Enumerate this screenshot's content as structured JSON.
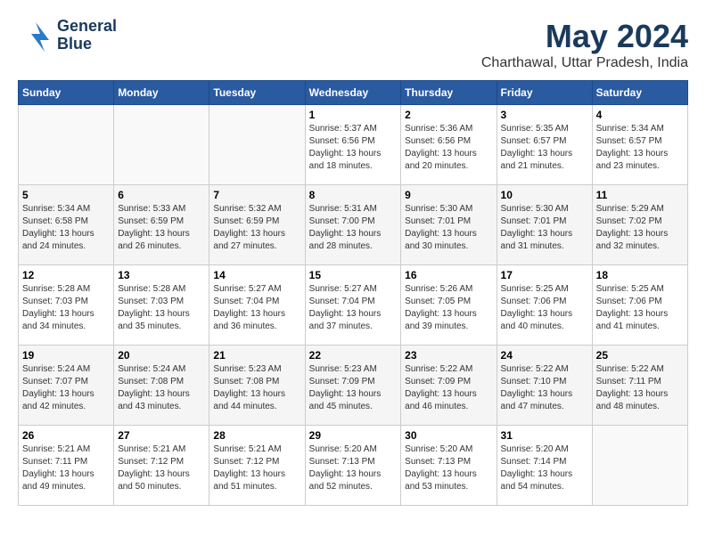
{
  "header": {
    "logo_line1": "General",
    "logo_line2": "Blue",
    "main_title": "May 2024",
    "subtitle": "Charthawal, Uttar Pradesh, India"
  },
  "calendar": {
    "weekdays": [
      "Sunday",
      "Monday",
      "Tuesday",
      "Wednesday",
      "Thursday",
      "Friday",
      "Saturday"
    ],
    "weeks": [
      [
        {
          "day": "",
          "info": ""
        },
        {
          "day": "",
          "info": ""
        },
        {
          "day": "",
          "info": ""
        },
        {
          "day": "1",
          "info": "Sunrise: 5:37 AM\nSunset: 6:56 PM\nDaylight: 13 hours\nand 18 minutes."
        },
        {
          "day": "2",
          "info": "Sunrise: 5:36 AM\nSunset: 6:56 PM\nDaylight: 13 hours\nand 20 minutes."
        },
        {
          "day": "3",
          "info": "Sunrise: 5:35 AM\nSunset: 6:57 PM\nDaylight: 13 hours\nand 21 minutes."
        },
        {
          "day": "4",
          "info": "Sunrise: 5:34 AM\nSunset: 6:57 PM\nDaylight: 13 hours\nand 23 minutes."
        }
      ],
      [
        {
          "day": "5",
          "info": "Sunrise: 5:34 AM\nSunset: 6:58 PM\nDaylight: 13 hours\nand 24 minutes."
        },
        {
          "day": "6",
          "info": "Sunrise: 5:33 AM\nSunset: 6:59 PM\nDaylight: 13 hours\nand 26 minutes."
        },
        {
          "day": "7",
          "info": "Sunrise: 5:32 AM\nSunset: 6:59 PM\nDaylight: 13 hours\nand 27 minutes."
        },
        {
          "day": "8",
          "info": "Sunrise: 5:31 AM\nSunset: 7:00 PM\nDaylight: 13 hours\nand 28 minutes."
        },
        {
          "day": "9",
          "info": "Sunrise: 5:30 AM\nSunset: 7:01 PM\nDaylight: 13 hours\nand 30 minutes."
        },
        {
          "day": "10",
          "info": "Sunrise: 5:30 AM\nSunset: 7:01 PM\nDaylight: 13 hours\nand 31 minutes."
        },
        {
          "day": "11",
          "info": "Sunrise: 5:29 AM\nSunset: 7:02 PM\nDaylight: 13 hours\nand 32 minutes."
        }
      ],
      [
        {
          "day": "12",
          "info": "Sunrise: 5:28 AM\nSunset: 7:03 PM\nDaylight: 13 hours\nand 34 minutes."
        },
        {
          "day": "13",
          "info": "Sunrise: 5:28 AM\nSunset: 7:03 PM\nDaylight: 13 hours\nand 35 minutes."
        },
        {
          "day": "14",
          "info": "Sunrise: 5:27 AM\nSunset: 7:04 PM\nDaylight: 13 hours\nand 36 minutes."
        },
        {
          "day": "15",
          "info": "Sunrise: 5:27 AM\nSunset: 7:04 PM\nDaylight: 13 hours\nand 37 minutes."
        },
        {
          "day": "16",
          "info": "Sunrise: 5:26 AM\nSunset: 7:05 PM\nDaylight: 13 hours\nand 39 minutes."
        },
        {
          "day": "17",
          "info": "Sunrise: 5:25 AM\nSunset: 7:06 PM\nDaylight: 13 hours\nand 40 minutes."
        },
        {
          "day": "18",
          "info": "Sunrise: 5:25 AM\nSunset: 7:06 PM\nDaylight: 13 hours\nand 41 minutes."
        }
      ],
      [
        {
          "day": "19",
          "info": "Sunrise: 5:24 AM\nSunset: 7:07 PM\nDaylight: 13 hours\nand 42 minutes."
        },
        {
          "day": "20",
          "info": "Sunrise: 5:24 AM\nSunset: 7:08 PM\nDaylight: 13 hours\nand 43 minutes."
        },
        {
          "day": "21",
          "info": "Sunrise: 5:23 AM\nSunset: 7:08 PM\nDaylight: 13 hours\nand 44 minutes."
        },
        {
          "day": "22",
          "info": "Sunrise: 5:23 AM\nSunset: 7:09 PM\nDaylight: 13 hours\nand 45 minutes."
        },
        {
          "day": "23",
          "info": "Sunrise: 5:22 AM\nSunset: 7:09 PM\nDaylight: 13 hours\nand 46 minutes."
        },
        {
          "day": "24",
          "info": "Sunrise: 5:22 AM\nSunset: 7:10 PM\nDaylight: 13 hours\nand 47 minutes."
        },
        {
          "day": "25",
          "info": "Sunrise: 5:22 AM\nSunset: 7:11 PM\nDaylight: 13 hours\nand 48 minutes."
        }
      ],
      [
        {
          "day": "26",
          "info": "Sunrise: 5:21 AM\nSunset: 7:11 PM\nDaylight: 13 hours\nand 49 minutes."
        },
        {
          "day": "27",
          "info": "Sunrise: 5:21 AM\nSunset: 7:12 PM\nDaylight: 13 hours\nand 50 minutes."
        },
        {
          "day": "28",
          "info": "Sunrise: 5:21 AM\nSunset: 7:12 PM\nDaylight: 13 hours\nand 51 minutes."
        },
        {
          "day": "29",
          "info": "Sunrise: 5:20 AM\nSunset: 7:13 PM\nDaylight: 13 hours\nand 52 minutes."
        },
        {
          "day": "30",
          "info": "Sunrise: 5:20 AM\nSunset: 7:13 PM\nDaylight: 13 hours\nand 53 minutes."
        },
        {
          "day": "31",
          "info": "Sunrise: 5:20 AM\nSunset: 7:14 PM\nDaylight: 13 hours\nand 54 minutes."
        },
        {
          "day": "",
          "info": ""
        }
      ]
    ]
  }
}
